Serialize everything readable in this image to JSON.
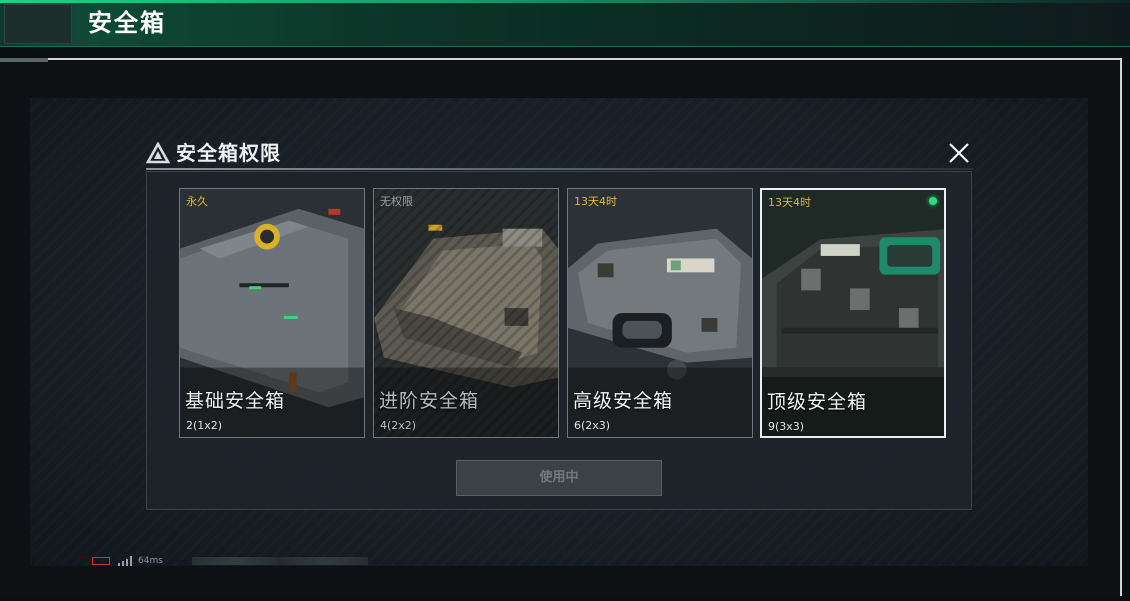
{
  "header": {
    "title": "安全箱"
  },
  "modal": {
    "title": "安全箱权限",
    "cards": [
      {
        "badge": "永久",
        "name": "基础安全箱",
        "capacity": "2(1x2)",
        "state": "available"
      },
      {
        "badge": "无权限",
        "name": "进阶安全箱",
        "capacity": "4(2x2)",
        "state": "locked"
      },
      {
        "badge": "13天4时",
        "name": "高级安全箱",
        "capacity": "6(2x3)",
        "state": "available"
      },
      {
        "badge": "13天4时",
        "name": "顶级安全箱",
        "capacity": "9(3x3)",
        "state": "selected",
        "active": true
      }
    ],
    "use_button_label": "使用中"
  },
  "status": {
    "ping": "64ms"
  },
  "colors": {
    "accent": "#27e07a",
    "badge": "#e1b53a",
    "header_green": "#0f4a36"
  },
  "icons": {
    "warning": "warning-triangle-icon",
    "close": "close-icon",
    "battery": "battery-icon",
    "signal": "signal-icon"
  }
}
